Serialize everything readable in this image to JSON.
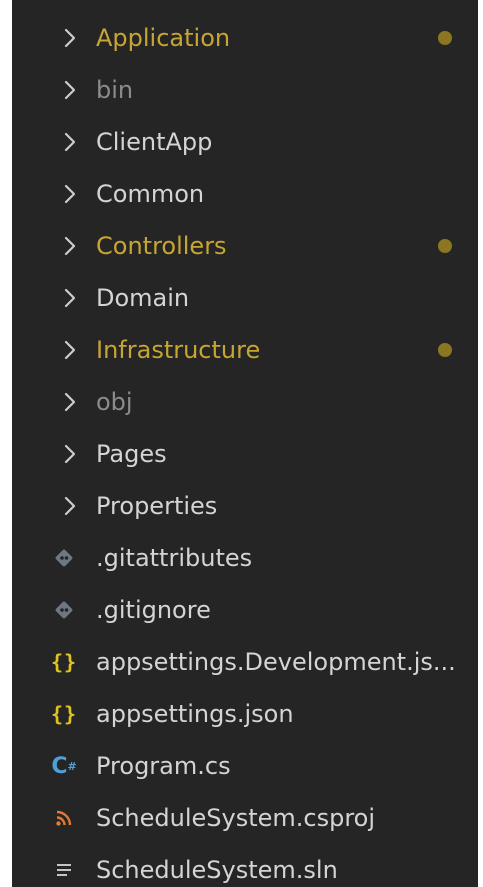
{
  "colors": {
    "modified": "#c7a533",
    "dimmed": "#8b8b8b",
    "normal": "#d4d4d4",
    "modified_dot": "#8b7722",
    "git_icon": "#6e7681",
    "json_icon": "#e0c31e",
    "csharp_icon": "#4f9fd8",
    "rss_icon": "#e37933",
    "sln_icon": "#c5c5c5"
  },
  "explorer": {
    "folders": [
      {
        "label": "Application",
        "status": "modified"
      },
      {
        "label": "bin",
        "status": "ignored"
      },
      {
        "label": "ClientApp",
        "status": "normal"
      },
      {
        "label": "Common",
        "status": "normal"
      },
      {
        "label": "Controllers",
        "status": "modified"
      },
      {
        "label": "Domain",
        "status": "normal"
      },
      {
        "label": "Infrastructure",
        "status": "modified"
      },
      {
        "label": "obj",
        "status": "ignored"
      },
      {
        "label": "Pages",
        "status": "normal"
      },
      {
        "label": "Properties",
        "status": "normal"
      }
    ],
    "files": [
      {
        "label": ".gitattributes",
        "icon": "git-icon"
      },
      {
        "label": ".gitignore",
        "icon": "git-icon"
      },
      {
        "label": "appsettings.Development.js...",
        "icon": "json-braces-icon"
      },
      {
        "label": "appsettings.json",
        "icon": "json-braces-icon"
      },
      {
        "label": "Program.cs",
        "icon": "csharp-icon"
      },
      {
        "label": "ScheduleSystem.csproj",
        "icon": "rss-icon"
      },
      {
        "label": "ScheduleSystem.sln",
        "icon": "solution-list-icon"
      }
    ]
  }
}
